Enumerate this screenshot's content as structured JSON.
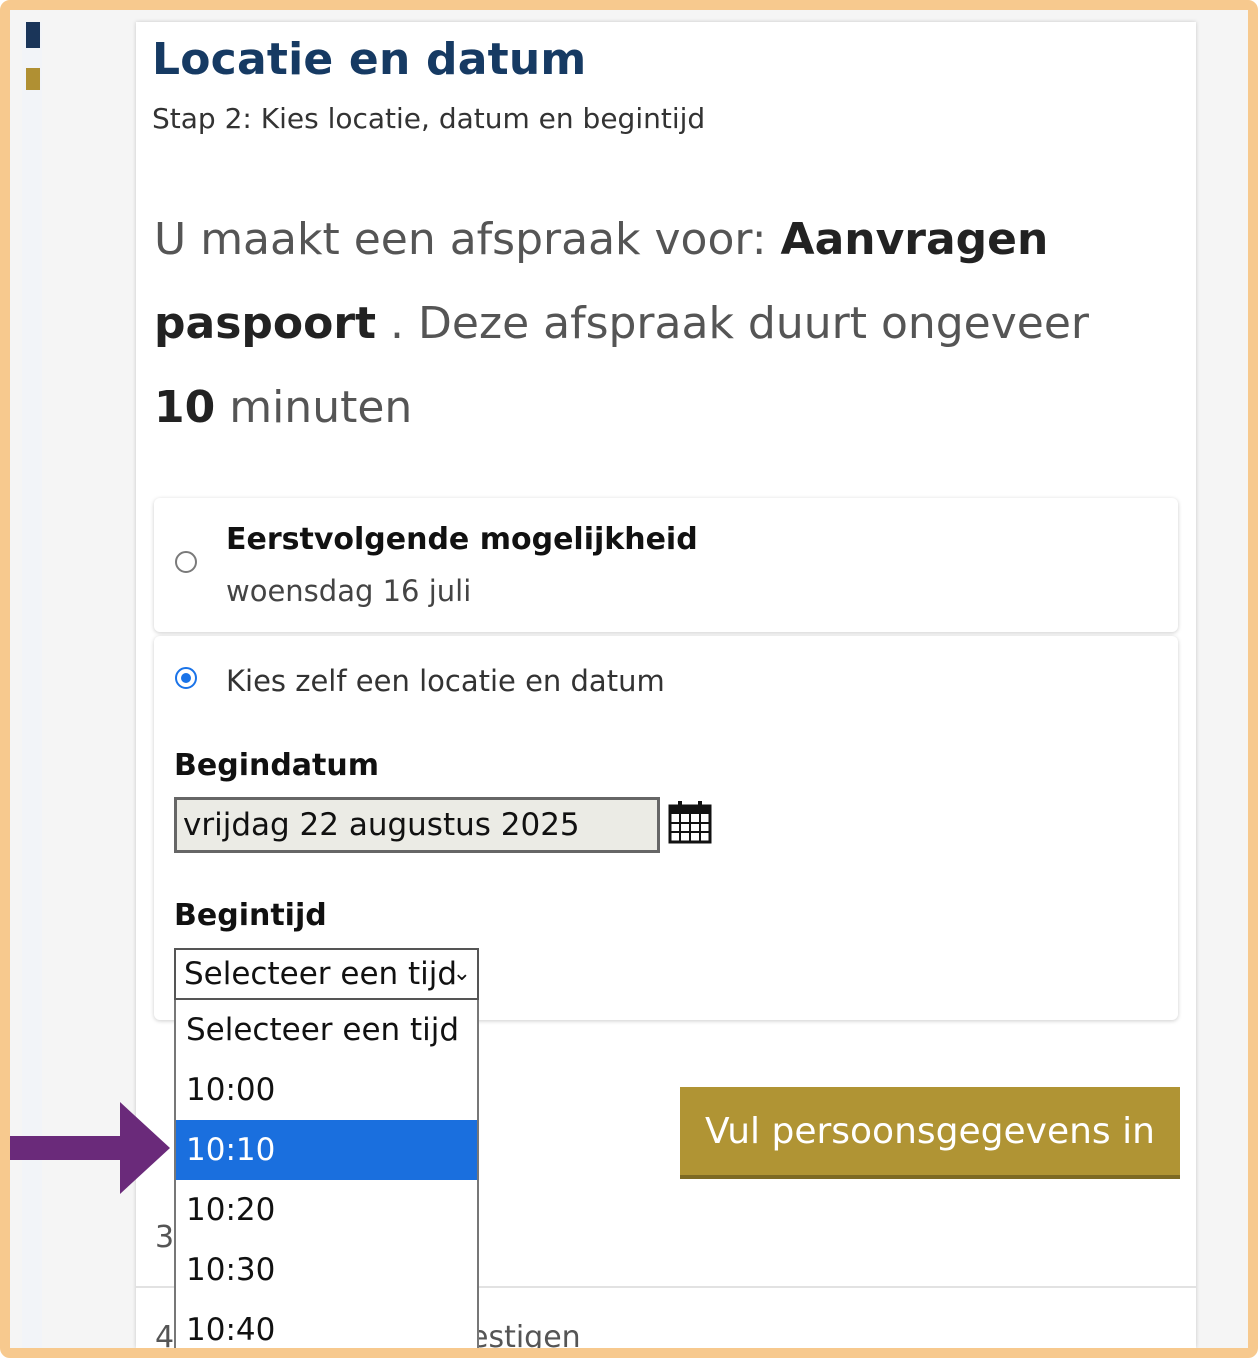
{
  "header": {
    "title": "Locatie en datum",
    "subtitle": "Stap 2: Kies locatie, datum en begintijd"
  },
  "intro": {
    "prefix": "U maakt een afspraak voor: ",
    "service": "Aanvragen paspoort",
    "middle": " . Deze afspraak duurt ongeveer ",
    "duration": "10",
    "suffix": " minuten"
  },
  "options": {
    "first": {
      "title": "Eerstvolgende mogelijkheid",
      "date": "woensdag 16 juli",
      "selected": false
    },
    "custom": {
      "label": "Kies zelf een locatie en datum",
      "selected": true
    }
  },
  "form": {
    "begindatum_label": "Begindatum",
    "begindatum_value": "vrijdag 22 augustus 2025",
    "begintijd_label": "Begintijd",
    "begintijd_selected": "Selecteer een tijd",
    "time_options": [
      "Selecteer een tijd",
      "10:00",
      "10:10",
      "10:20",
      "10:30",
      "10:40"
    ],
    "highlighted_option": "10:10"
  },
  "actions": {
    "next_label": "Vul persoonsgegevens in"
  },
  "steps": {
    "step3_partial": "3",
    "step4_partial_num": "4",
    "step4_partial_text": "estigen"
  },
  "colors": {
    "title": "#163a63",
    "button": "#b09434",
    "highlight": "#1a6fde",
    "radio_on": "#1a73e8",
    "arrow": "#6a2a7a",
    "frame": "#f7c98e"
  },
  "icons": {
    "calendar": "calendar-icon",
    "chevron": "chevron-down-icon",
    "arrow": "arrow-right-icon"
  }
}
